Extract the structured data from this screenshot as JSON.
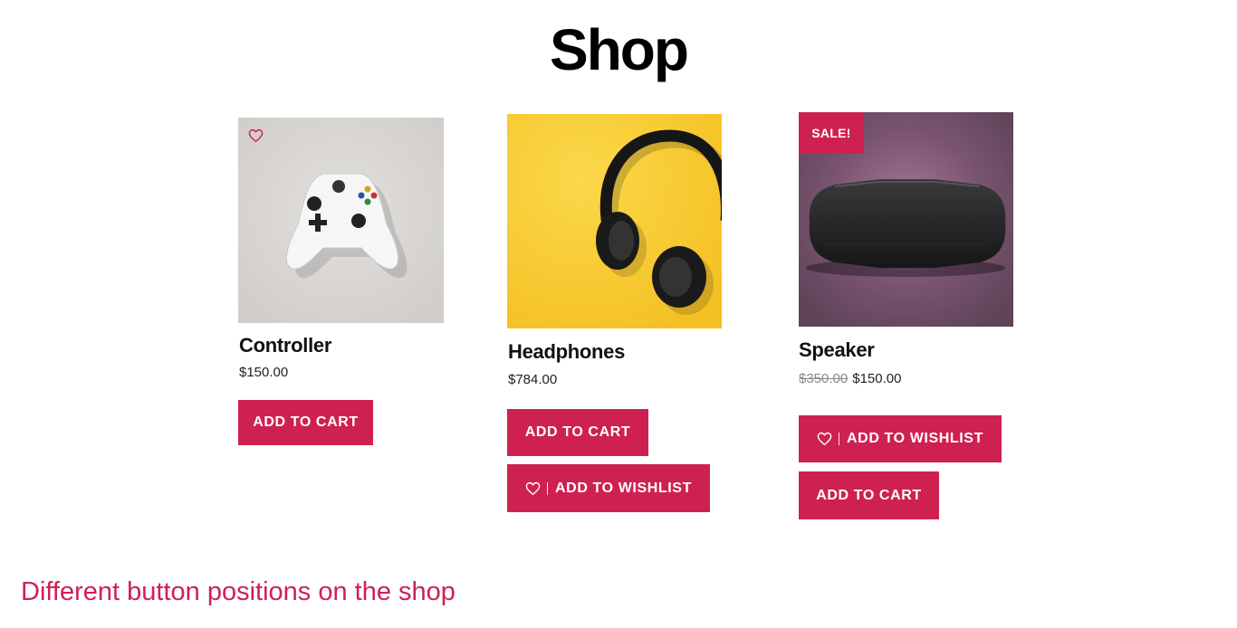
{
  "page": {
    "title": "Shop"
  },
  "colors": {
    "accent": "#ce2151"
  },
  "products": [
    {
      "name": "Controller",
      "price": "$150.00",
      "image": "white-game-controller",
      "wishlist_icon": "heart-outline-icon",
      "buttons": {
        "add_to_cart": "ADD TO CART"
      }
    },
    {
      "name": "Headphones",
      "price": "$784.00",
      "image": "black-headphones-on-yellow",
      "buttons": {
        "add_to_cart": "ADD TO CART",
        "add_to_wishlist": "ADD TO WISHLIST"
      }
    },
    {
      "name": "Speaker",
      "old_price": "$350.00",
      "price": "$150.00",
      "badge": "SALE!",
      "image": "black-speaker-on-purple",
      "buttons": {
        "add_to_wishlist": "ADD TO WISHLIST",
        "add_to_cart": "ADD TO CART"
      }
    }
  ],
  "caption": "Different button positions on the shop"
}
